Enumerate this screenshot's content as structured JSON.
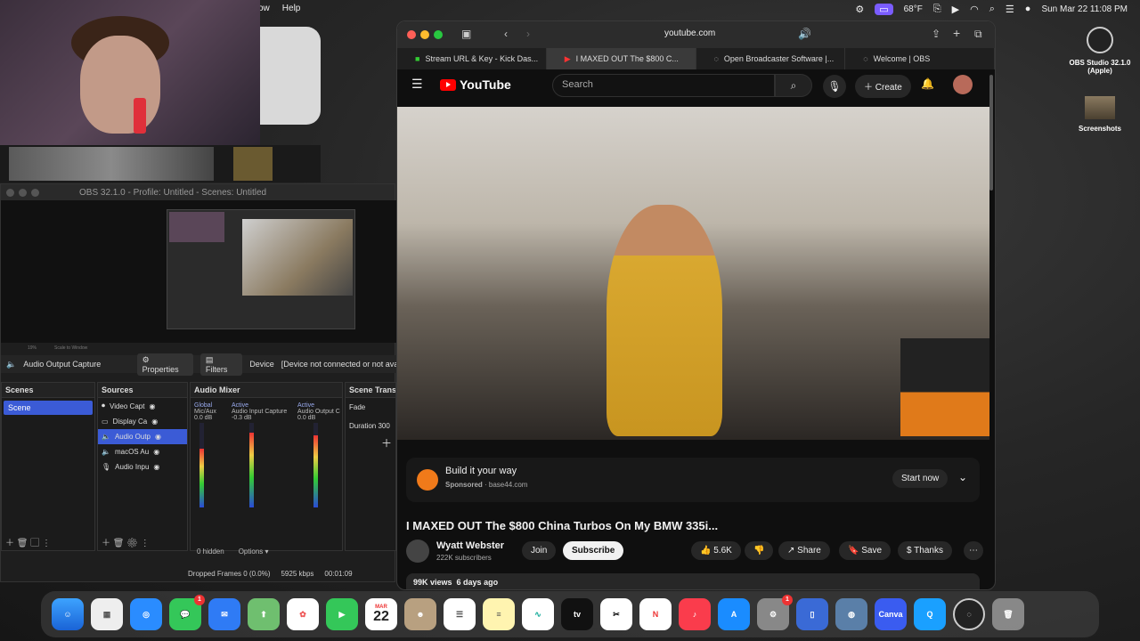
{
  "menubar": {
    "app_items": [
      "ow",
      "Help"
    ],
    "temperature": "68°F",
    "datetime": "Sun Mar 22  11:08 PM"
  },
  "obs": {
    "title": "OBS 32.1.0 - Profile: Untitled - Scenes: Untitled",
    "zoom": "19%",
    "scale_mode": "Scale to Window",
    "selected_source": "Audio Output Capture",
    "properties_label": "Properties",
    "filters_label": "Filters",
    "device_label": "Device",
    "device_value": "[Device not connected or not avail",
    "scenes_header": "Scenes",
    "scenes": [
      "Scene"
    ],
    "sources_header": "Sources",
    "sources": [
      "Video Capt",
      "Display Ca",
      "Audio Outp",
      "macOS Au",
      "Audio Inpu"
    ],
    "mixer_header": "Audio Mixer",
    "mixer": [
      {
        "name": "Mic/Aux",
        "tag": "Global",
        "db": "0.0 dB"
      },
      {
        "name": "Audio Input Capture",
        "tag": "Active",
        "db": "-0.3 dB"
      },
      {
        "name": "Audio Output C",
        "tag": "Active",
        "db": "0.0 dB"
      }
    ],
    "transitions_header": "Scene Trans",
    "transition_type": "Fade",
    "duration_label": "Duration",
    "duration_value": "300",
    "hidden_count": "0 hidden",
    "options_label": "Options",
    "dropped_frames": "Dropped Frames 0 (0.0%)",
    "bitrate": "5925 kbps",
    "elapsed": "00:01:09"
  },
  "safari": {
    "url": "youtube.com",
    "tabs": [
      {
        "label": "Stream URL & Key - Kick Das..."
      },
      {
        "label": "I MAXED OUT The $800 C..."
      },
      {
        "label": "Open Broadcaster Software |..."
      },
      {
        "label": "Welcome | OBS"
      }
    ]
  },
  "youtube": {
    "logo": "YouTube",
    "search_placeholder": "Search",
    "create_label": "Create",
    "ad_title": "Build it your way",
    "ad_sponsored": "Sponsored",
    "ad_domain": "base44.com",
    "ad_cta": "Start now",
    "video_title": "I MAXED OUT The $800 China Turbos On My BMW 335i...",
    "channel_name": "Wyatt Webster",
    "subscribers": "222K subscribers",
    "join_label": "Join",
    "subscribe_label": "Subscribe",
    "likes": "5.6K",
    "share_label": "Share",
    "save_label": "Save",
    "thanks_label": "Thanks",
    "views": "99K views",
    "age": "6 days ago"
  },
  "desktop": {
    "obs_icon_label": "OBS Studio 32.1.0 (Apple)",
    "screenshots_label": "Screenshots"
  },
  "dock": {
    "calendar_month": "MAR",
    "calendar_day": "22",
    "messages_badge": "1",
    "settings_badge": "1",
    "tv_label": "tv",
    "canva_label": "Canva"
  }
}
